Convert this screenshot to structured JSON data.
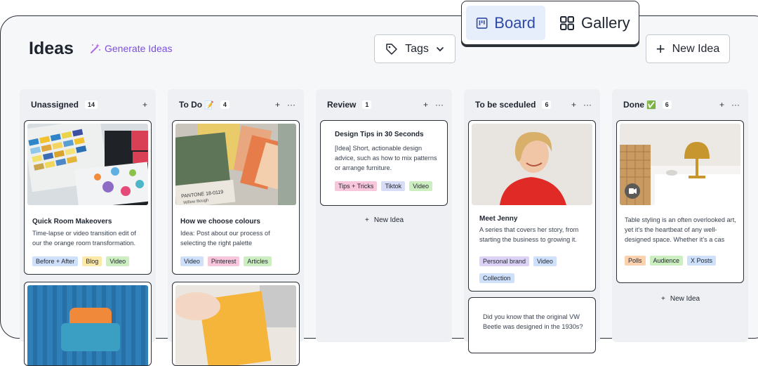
{
  "page": {
    "title": "Ideas",
    "generate_label": "Generate Ideas"
  },
  "toolbar": {
    "tags_label": "Tags",
    "new_idea_label": "New Idea"
  },
  "view_switcher": {
    "board_label": "Board",
    "gallery_label": "Gallery"
  },
  "columns": [
    {
      "title": "Unassigned",
      "count": "14",
      "cards": [
        {
          "title": "Quick Room Makeovers",
          "desc": "Time-lapse or video transition edit of our the orange room transformation.",
          "tags": [
            "Before + After",
            "Blog",
            "Video"
          ]
        }
      ]
    },
    {
      "title": "To Do",
      "emoji": "📝",
      "count": "4",
      "cards": [
        {
          "title": "How we choose colours",
          "desc": "Idea: Post about our process of selecting the right palette",
          "tags": [
            "Video",
            "Pinterest",
            "Articles"
          ]
        }
      ]
    },
    {
      "title": "Review",
      "count": "1",
      "cards": [
        {
          "title": "Design Tips in 30 Seconds",
          "desc": "[Idea] Short, actionable design advice, such as how to mix patterns or arrange furniture.",
          "tags": [
            "Tips + Tricks",
            "Tiktok",
            "Video"
          ]
        }
      ],
      "new_idea": "New Idea"
    },
    {
      "title": "To be sceduled",
      "count": "6",
      "cards": [
        {
          "title": "Meet Jenny",
          "desc": "A series that covers her story, from starting the business to growing it.",
          "tags": [
            "Personal brand",
            "Video",
            "Collection"
          ]
        },
        {
          "desc": "Did you know that the original VW Beetle was designed in the 1930s?"
        }
      ]
    },
    {
      "title": "Done",
      "emoji": "✅",
      "count": "6",
      "cards": [
        {
          "desc": "Table styling is an often overlooked art, yet it's the heartbeat of any well-designed space. Whether it's a cas",
          "tags": [
            "Polls",
            "Audience",
            "X Posts"
          ]
        }
      ],
      "new_idea": "New Idea"
    }
  ],
  "colors": {
    "accent": "#2f4aa6",
    "generate": "#7b4ee0",
    "tag_blue": "#cfe0fb",
    "tag_yellow": "#fde9a8",
    "tag_green": "#cdeec0",
    "tag_pink": "#f9c7dc",
    "tag_purple": "#ddd3f6",
    "tag_orange": "#fbd2ad",
    "tag_lavender": "#d9dcf7"
  }
}
